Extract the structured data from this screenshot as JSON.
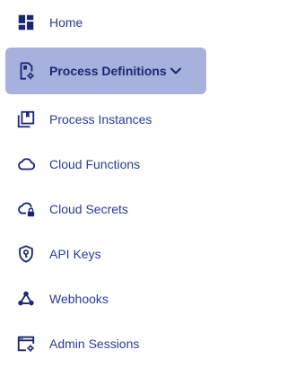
{
  "colors": {
    "icon": "#1b2674",
    "label": "#2a3b9a",
    "active_background": "#a7b1dd",
    "active_label": "#1b2674"
  },
  "nav": {
    "items": [
      {
        "label": "Home",
        "icon": "dashboard-icon",
        "active": false
      },
      {
        "label": "Process Definitions",
        "icon": "document-settings-icon",
        "active": true,
        "expanded": true
      },
      {
        "label": "Process Instances",
        "icon": "bookmark-stack-icon",
        "active": false
      },
      {
        "label": "Cloud Functions",
        "icon": "cloud-icon",
        "active": false
      },
      {
        "label": "Cloud Secrets",
        "icon": "cloud-lock-icon",
        "active": false
      },
      {
        "label": "API Keys",
        "icon": "shield-key-icon",
        "active": false
      },
      {
        "label": "Webhooks",
        "icon": "webhook-icon",
        "active": false
      },
      {
        "label": "Admin Sessions",
        "icon": "browser-settings-icon",
        "active": false
      }
    ]
  }
}
